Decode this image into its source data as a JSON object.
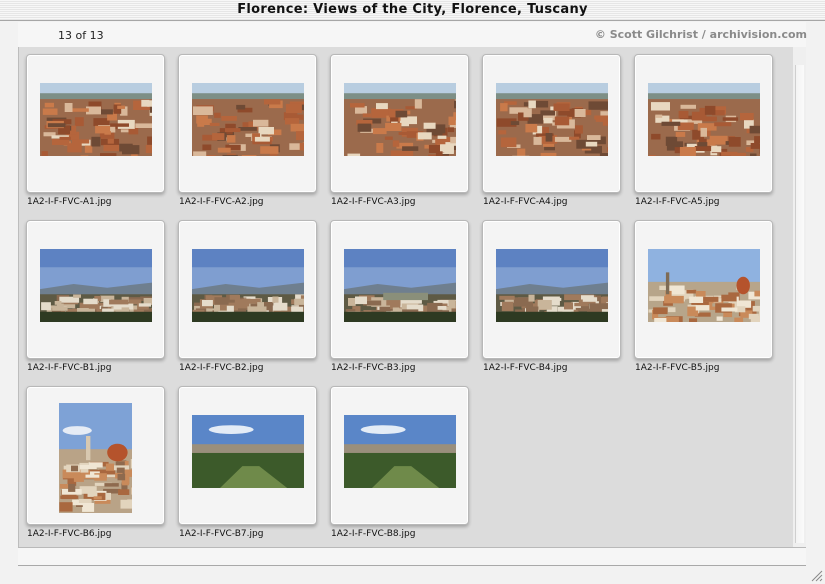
{
  "window": {
    "title": "Florence: Views of the City, Florence, Tuscany"
  },
  "header": {
    "count": "13 of 13",
    "credit": "© Scott Gilchrist / archivision.com"
  },
  "thumbnails": [
    {
      "filename": "1A2-I-F-FVC-A1.jpg",
      "scene": "city-rooftops"
    },
    {
      "filename": "1A2-I-F-FVC-A2.jpg",
      "scene": "city-rooftops"
    },
    {
      "filename": "1A2-I-F-FVC-A3.jpg",
      "scene": "city-rooftops"
    },
    {
      "filename": "1A2-I-F-FVC-A4.jpg",
      "scene": "city-rooftops"
    },
    {
      "filename": "1A2-I-F-FVC-A5.jpg",
      "scene": "city-rooftops"
    },
    {
      "filename": "1A2-I-F-FVC-B1.jpg",
      "scene": "hills-panorama"
    },
    {
      "filename": "1A2-I-F-FVC-B2.jpg",
      "scene": "hills-panorama"
    },
    {
      "filename": "1A2-I-F-FVC-B3.jpg",
      "scene": "river-panorama"
    },
    {
      "filename": "1A2-I-F-FVC-B4.jpg",
      "scene": "hills-panorama"
    },
    {
      "filename": "1A2-I-F-FVC-B5.jpg",
      "scene": "duomo-panorama"
    },
    {
      "filename": "1A2-I-F-FVC-B6.jpg",
      "scene": "duomo-portrait"
    },
    {
      "filename": "1A2-I-F-FVC-B7.jpg",
      "scene": "garden-panorama"
    },
    {
      "filename": "1A2-I-F-FVC-B8.jpg",
      "scene": "garden-panorama"
    }
  ]
}
